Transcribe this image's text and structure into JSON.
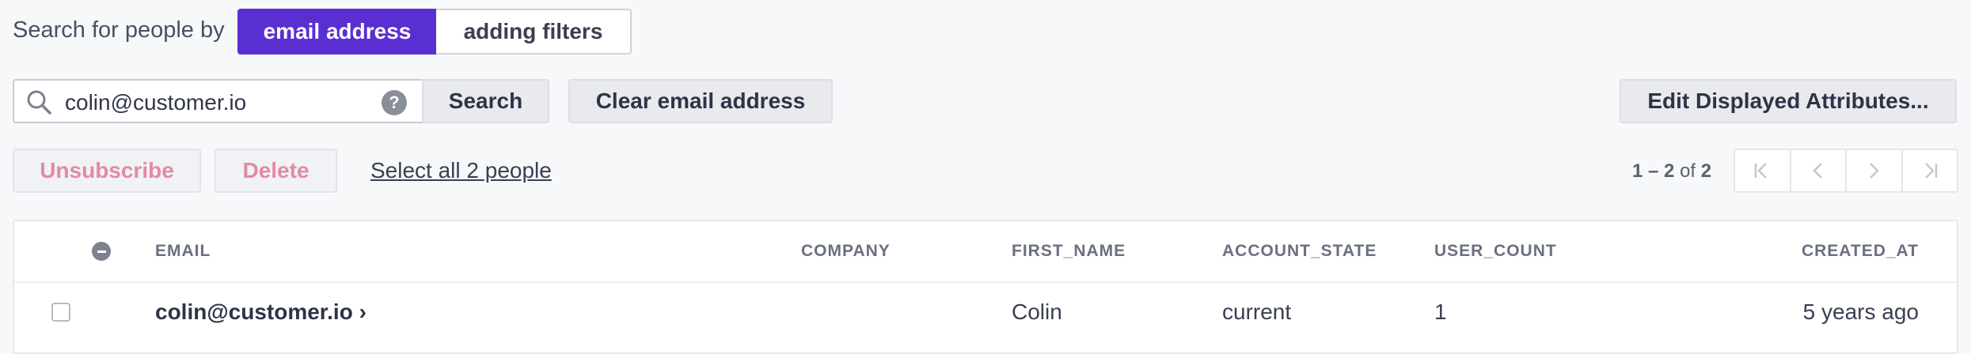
{
  "search_mode": {
    "label": "Search for people by",
    "options": [
      "email address",
      "adding filters"
    ],
    "selected": "email address"
  },
  "search": {
    "value": "colin@customer.io",
    "help_icon": "question-icon",
    "search_button": "Search",
    "clear_button": "Clear email address"
  },
  "edit_attributes_button": "Edit Displayed Attributes...",
  "actions": {
    "unsubscribe": "Unsubscribe",
    "delete": "Delete",
    "select_all": "Select all 2 people"
  },
  "pagination": {
    "range": "1 – 2",
    "of": "of",
    "total": "2",
    "buttons": [
      "first-page-icon",
      "previous-page-icon",
      "next-page-icon",
      "last-page-icon"
    ]
  },
  "table": {
    "columns": [
      "EMAIL",
      "COMPANY",
      "FIRST_NAME",
      "ACCOUNT_STATE",
      "USER_COUNT",
      "CREATED_AT"
    ],
    "rows": [
      {
        "email": "colin@customer.io ›",
        "company": "",
        "first_name": "Colin",
        "account_state": "current",
        "user_count": "1",
        "created_at": "5 years ago"
      }
    ]
  },
  "colors": {
    "accent": "#5a2fd1",
    "danger_muted": "#e38aa2",
    "background": "#f7f8fa"
  }
}
